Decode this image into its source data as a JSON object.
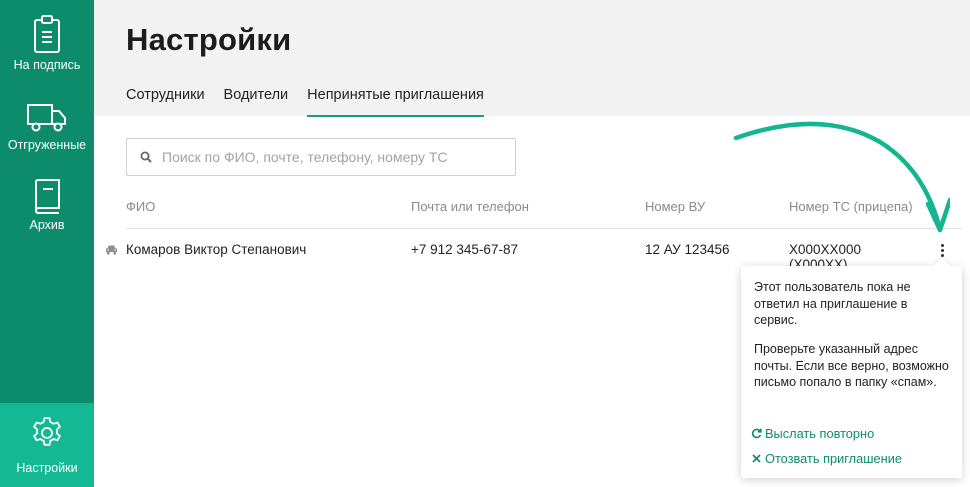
{
  "sidebar": {
    "items": [
      {
        "label": "На подпись",
        "icon": "clipboard-icon"
      },
      {
        "label": "Отгруженные",
        "icon": "truck-icon"
      },
      {
        "label": "Архив",
        "icon": "book-icon"
      },
      {
        "label": "Настройки",
        "icon": "gear-icon",
        "active": true
      }
    ]
  },
  "header": {
    "title": "Настройки",
    "tabs": [
      {
        "label": "Сотрудники"
      },
      {
        "label": "Водители"
      },
      {
        "label": "Непринятые приглашения",
        "active": true
      }
    ]
  },
  "search": {
    "placeholder": "Поиск по ФИО, почте, телефону, номеру ТС",
    "value": ""
  },
  "table": {
    "columns": [
      "ФИО",
      "Почта или телефон",
      "Номер ВУ",
      "Номер ТС (прицепа)"
    ],
    "rows": [
      {
        "icon": "car-icon",
        "name": "Комаров Виктор Степанович",
        "contact": "+7 912 345-67-87",
        "license": "12 АУ 123456",
        "ts_line1": "Х000ХХ000",
        "ts_line2": "(Х000ХХ)"
      }
    ]
  },
  "popover": {
    "text1": "Этот пользователь пока не ответил на приглашение в сервис.",
    "text2": "Проверьте указанный адрес почты. Если все верно, возможно письмо попало в папку «спам».",
    "resend_label": "Выслать повторно",
    "revoke_label": "Отозвать приглашение"
  },
  "colors": {
    "sidebar_bg": "#0d8c6c",
    "sidebar_active": "#14b894",
    "accent": "#14a07f",
    "arrow": "#15b592"
  }
}
